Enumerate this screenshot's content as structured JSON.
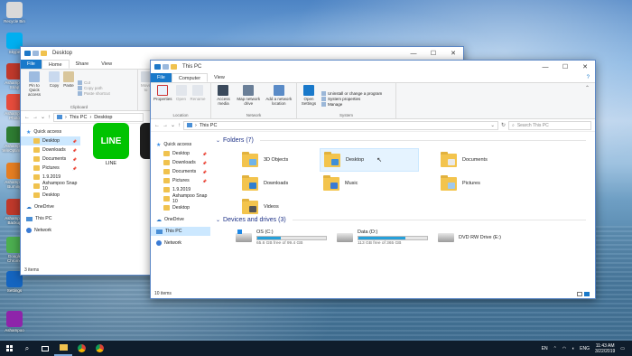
{
  "desktop": {
    "icons": [
      {
        "label": "Recycle Bin",
        "color": "#d9d9d9"
      },
      {
        "label": "Skype",
        "color": "#00aff0"
      },
      {
        "label": "Ashampoo Snap",
        "color": "#c0392b"
      },
      {
        "label": "Ashampoo Photo",
        "color": "#e74c3c"
      },
      {
        "label": "Ashampoo WinOptimizer",
        "color": "#2e7d32"
      },
      {
        "label": "Ashampoo Burning",
        "color": "#e67e22"
      },
      {
        "label": "Ashampoo Backup",
        "color": "#c0392b"
      },
      {
        "label": "Google Chrome",
        "color": "#4caf50"
      },
      {
        "label": "Settings",
        "color": "#1565c0"
      },
      {
        "label": "Ashampoo",
        "color": "#8e24aa"
      }
    ]
  },
  "back_window": {
    "title": "Desktop",
    "tabs": [
      "File",
      "Home",
      "Share",
      "View"
    ],
    "ribbon": {
      "pin_label": "Pin to Quick access",
      "copy_label": "Copy",
      "paste_label": "Paste",
      "cut_label": "Cut",
      "copy_path_label": "Copy path",
      "paste_shortcut_label": "Paste shortcut",
      "move_label": "Move to",
      "clipboard_group": "Clipboard"
    },
    "address": [
      "This PC",
      "Desktop"
    ],
    "nav": [
      {
        "label": "Quick access",
        "kind": "star"
      },
      {
        "label": "Desktop",
        "kind": "folder",
        "pin": true,
        "selected": true
      },
      {
        "label": "Downloads",
        "kind": "folder",
        "pin": true
      },
      {
        "label": "Documents",
        "kind": "folder",
        "pin": true
      },
      {
        "label": "Pictures",
        "kind": "folder",
        "pin": true
      },
      {
        "label": "1.9.2019",
        "kind": "folder"
      },
      {
        "label": "Ashampoo Snap 10",
        "kind": "folder"
      },
      {
        "label": "Desktop",
        "kind": "folder"
      },
      {
        "label": "OneDrive",
        "kind": "cloud"
      },
      {
        "label": "This PC",
        "kind": "pc"
      },
      {
        "label": "Network",
        "kind": "net"
      }
    ],
    "files": [
      {
        "label": "LINE",
        "color": "#00c300"
      },
      {
        "label": "Micr",
        "color": "#1e1e1e"
      }
    ],
    "status": "3 items"
  },
  "front_window": {
    "title": "This PC",
    "tabs": [
      "File",
      "Computer",
      "View"
    ],
    "ribbon": {
      "properties_label": "Properties",
      "open_label": "Open",
      "rename_label": "Rename",
      "location_group": "Location",
      "access_media_label": "Access media",
      "map_drive_label": "Map network drive",
      "add_location_label": "Add a network location",
      "network_group": "Network",
      "open_settings_label": "Open Settings",
      "uninstall_label": "Uninstall or change a program",
      "system_props_label": "System properties",
      "manage_label": "Manage",
      "system_group": "System"
    },
    "address": [
      "This PC"
    ],
    "search_placeholder": "Search This PC",
    "nav": [
      {
        "label": "Quick access",
        "kind": "star"
      },
      {
        "label": "Desktop",
        "kind": "folder",
        "pin": true
      },
      {
        "label": "Downloads",
        "kind": "folder",
        "pin": true
      },
      {
        "label": "Documents",
        "kind": "folder",
        "pin": true
      },
      {
        "label": "Pictures",
        "kind": "folder",
        "pin": true
      },
      {
        "label": "1.9.2019",
        "kind": "folder"
      },
      {
        "label": "Ashampoo Snap 10",
        "kind": "folder"
      },
      {
        "label": "Desktop",
        "kind": "folder"
      },
      {
        "label": "OneDrive",
        "kind": "cloud"
      },
      {
        "label": "This PC",
        "kind": "pc",
        "selected": true
      },
      {
        "label": "Network",
        "kind": "net"
      }
    ],
    "folders_header": "Folders (7)",
    "folders": [
      {
        "label": "3D Objects",
        "badge": "#6fb3e8"
      },
      {
        "label": "Desktop",
        "badge": "#3f8fd8",
        "highlight": true
      },
      {
        "label": "Documents",
        "badge": "#e9e9e9"
      },
      {
        "label": "Downloads",
        "badge": "#2f7fd0"
      },
      {
        "label": "Music",
        "badge": "#3a7bd5"
      },
      {
        "label": "Pictures",
        "badge": "#9fc9ee"
      },
      {
        "label": "Videos",
        "badge": "#555555"
      }
    ],
    "drives_header": "Devices and drives (3)",
    "drives": [
      {
        "label": "OS (C:)",
        "free": "65.6 GB free of 99.4 GB",
        "used_fraction": 0.34
      },
      {
        "label": "Data (D:)",
        "free": "113 GB free of 365 GB",
        "used_fraction": 0.69
      },
      {
        "label": "DVD RW Drive (E:)",
        "free": "",
        "used_fraction": null
      }
    ],
    "status": "10 items"
  },
  "taskbar": {
    "lang1": "EN",
    "lang2": "ENG",
    "time": "11:43 AM",
    "date": "3/22/2019"
  }
}
